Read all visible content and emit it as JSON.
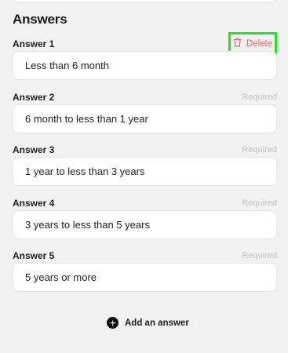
{
  "section": {
    "title": "Answers"
  },
  "answers": [
    {
      "label": "Answer 1",
      "value": "Less than 6 month",
      "action": "Delete"
    },
    {
      "label": "Answer 2",
      "value": "6 month to less than 1 year",
      "status": "Required"
    },
    {
      "label": "Answer 3",
      "value": "1 year to less than 3 years",
      "status": "Required"
    },
    {
      "label": "Answer 4",
      "value": "3 years to less than 5 years",
      "status": "Required"
    },
    {
      "label": "Answer 5",
      "value": "5 years or more",
      "status": "Required"
    }
  ],
  "add_button": {
    "label": "Add an answer",
    "icon": "plus-circle-icon"
  },
  "colors": {
    "delete": "#f06565",
    "highlight": "#1fe61f",
    "required": "#c4c4c4",
    "background": "#f2f2f2"
  }
}
